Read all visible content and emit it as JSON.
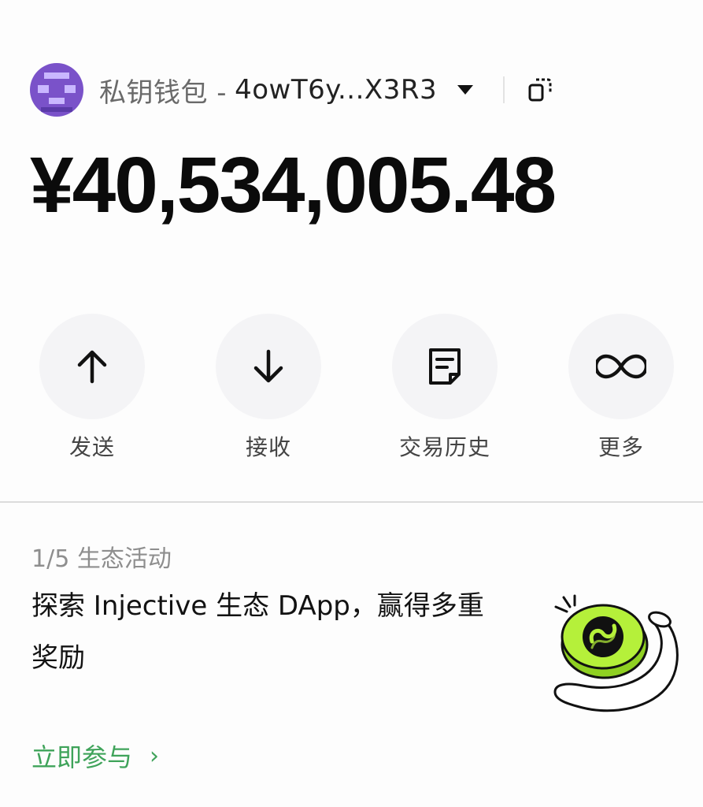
{
  "header": {
    "wallet_label": "私钥钱包 -",
    "address": "4owT6y...X3R3",
    "avatar_color": "#7a52c9"
  },
  "balance": {
    "amount": "¥40,534,005.48"
  },
  "actions": [
    {
      "label": "发送",
      "icon": "arrow-up-icon"
    },
    {
      "label": "接收",
      "icon": "arrow-down-icon"
    },
    {
      "label": "交易历史",
      "icon": "document-icon"
    },
    {
      "label": "更多",
      "icon": "infinity-icon"
    }
  ],
  "promo": {
    "counter": "1/5 生态活动",
    "title": "探索 Injective 生态 DApp，赢得多重奖励",
    "cta": "立即参与",
    "cta_color": "#3fa35a",
    "coin_color": "#b5f03a",
    "icon": "injective-coin-illustration"
  }
}
